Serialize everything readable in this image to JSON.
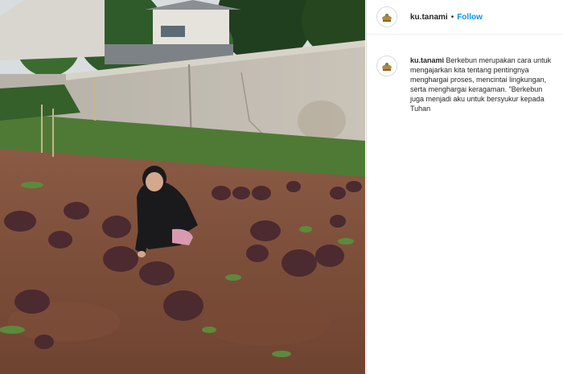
{
  "post": {
    "username": "ku.tanami",
    "separator": "•",
    "follow_label": "Follow",
    "caption": "Berkebun merupakan cara untuk mengajarkan kita tentang pentingnya menghargai proses, mencintai lingkungan, serta menghargai keragaman. \"Berkebun juga menjadi aku untuk bersyukur kepada Tuhan"
  },
  "icons": {
    "avatar": "ku-tanami-logo-icon"
  },
  "colors": {
    "link": "#0095f6",
    "text": "#262626",
    "border": "#dbdbdb"
  }
}
